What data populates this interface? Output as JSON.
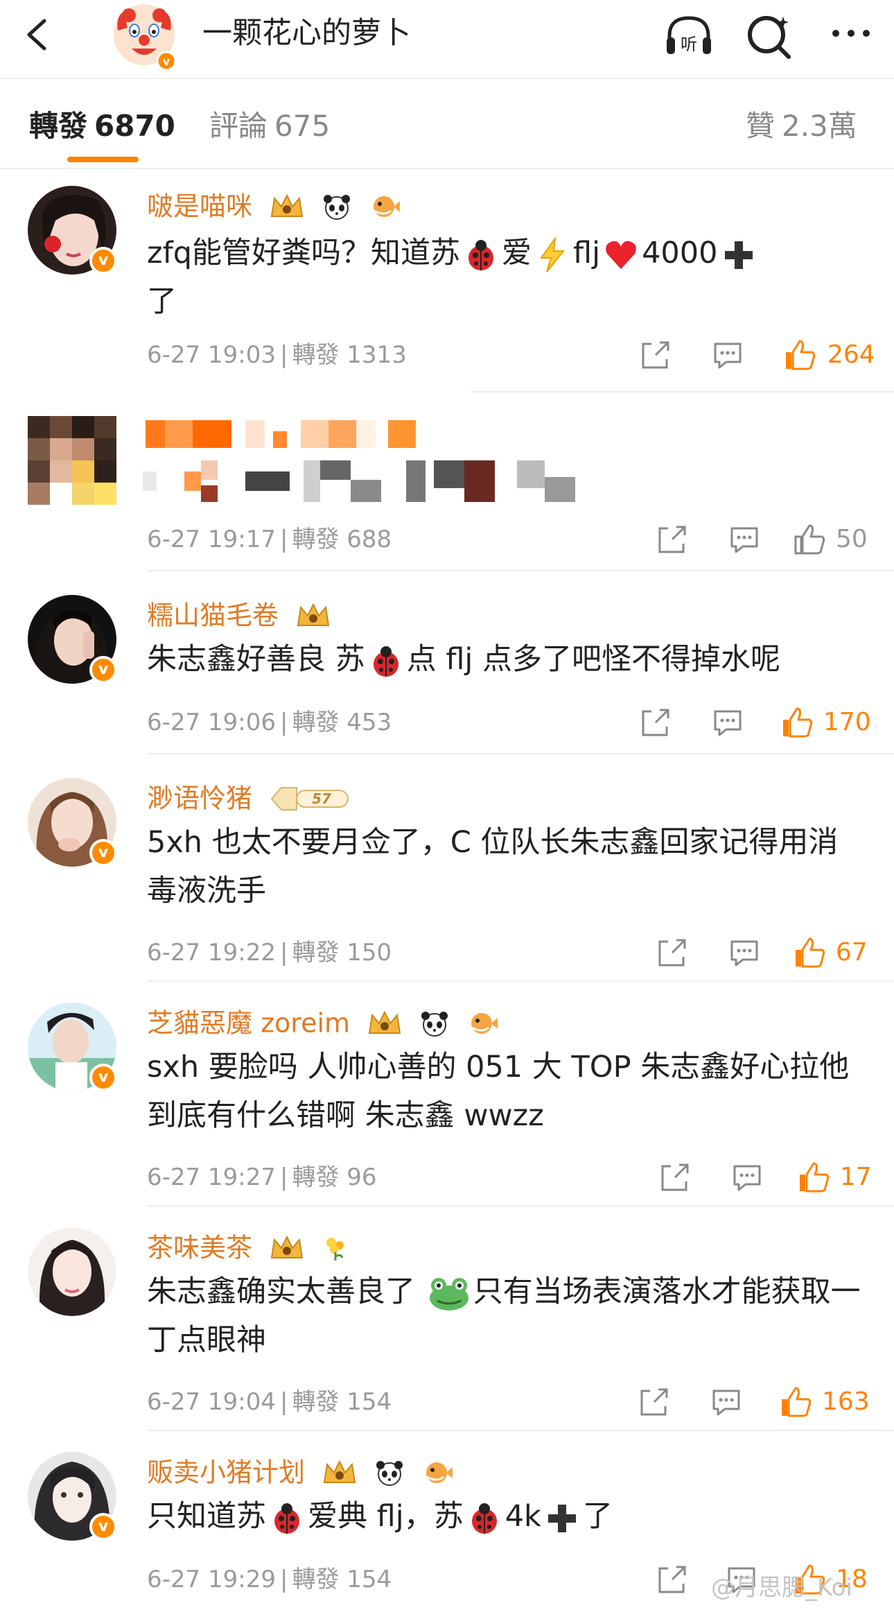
{
  "header": {
    "title": "一颗花心的萝卜"
  },
  "tabs": [
    {
      "label": "轉發",
      "count": "6870"
    },
    {
      "label": "評論",
      "count": "675"
    },
    {
      "label": "贊",
      "count": "2.3萬"
    }
  ],
  "comments": [
    {
      "name": "啵是喵咪",
      "text_a": "zfq能管好粪吗？知道苏",
      "text_b": "爱",
      "text_c": "flj",
      "text_d": "4000",
      "text_e": "了",
      "time": "6-27 19:03",
      "repost_label": "轉發",
      "reposts": "1313",
      "likes": "264"
    },
    {
      "name": "",
      "text": "",
      "time": "6-27 19:17",
      "repost_label": "轉發",
      "reposts": "688",
      "likes": "50"
    },
    {
      "name": "糯山猫毛卷",
      "text_a": "朱志鑫好善良 苏",
      "text_b": "点 flj 点多了吧怪不得掉水呢",
      "time": "6-27 19:06",
      "repost_label": "轉發",
      "reposts": "453",
      "likes": "170"
    },
    {
      "name": "渺语怜猪",
      "level": "57",
      "text": "5xh 也太不要月佥了，C 位队长朱志鑫回家记得用消毒液洗手",
      "time": "6-27 19:22",
      "repost_label": "轉發",
      "reposts": "150",
      "likes": "67"
    },
    {
      "name": "芝貓惡魔 zoreim",
      "text": "sxh 要脸吗 人帅心善的 051 大 TOP 朱志鑫好心拉他到底有什么错啊 朱志鑫 wwzz",
      "time": "6-27 19:27",
      "repost_label": "轉發",
      "reposts": "96",
      "likes": "17"
    },
    {
      "name": "茶味美茶",
      "text_a": "朱志鑫确实太善良了",
      "text_b": "只有当场表演落水才能获取一丁点眼神",
      "time": "6-27 19:04",
      "repost_label": "轉發",
      "reposts": "154",
      "likes": "163"
    },
    {
      "name": "贩卖小猪计划",
      "text_a": "只知道苏",
      "text_b": "爱典 flj，苏",
      "text_c": "4k",
      "text_d": "了",
      "time": "6-27 19:29",
      "repost_label": "轉發",
      "reposts": "154",
      "likes": "18"
    }
  ],
  "watermark": "@月思腮_Koi",
  "colors": {
    "accent": "#ff8200",
    "username": "#e07b25",
    "meta": "#9a9a9a",
    "badge": "#ff8a00"
  },
  "icons": [
    "back-arrow-icon",
    "listen-headphones-icon",
    "search-icon",
    "more-icon",
    "repost-icon",
    "comment-icon",
    "like-icon",
    "crown-badge-icon",
    "panda-icon",
    "pufferfish-icon",
    "ladybug-emoji-icon",
    "lightning-emoji-icon",
    "heart-emoji-icon",
    "plus-emoji-icon",
    "frog-emoji-icon",
    "flower-icon",
    "verified-badge-icon"
  ]
}
